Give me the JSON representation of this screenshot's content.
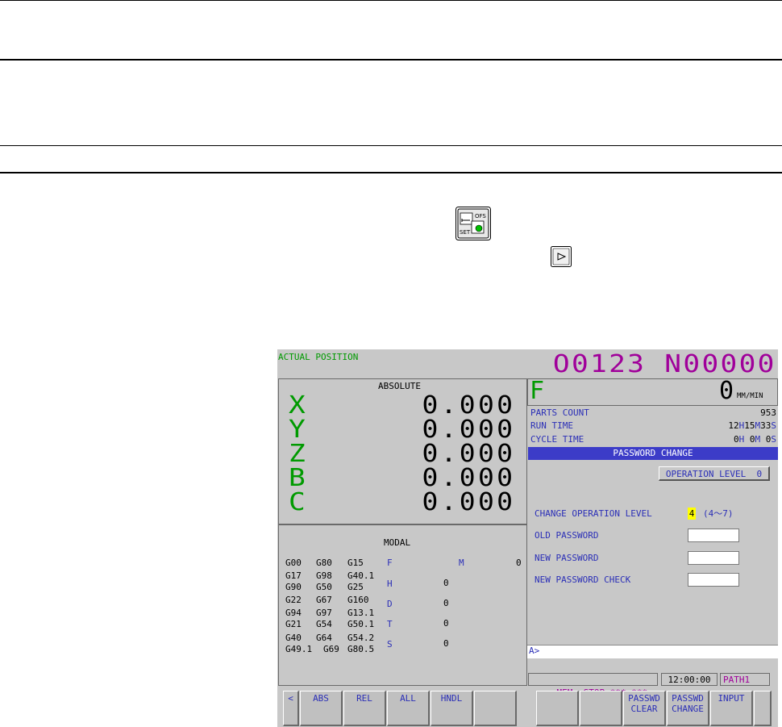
{
  "cnc": {
    "screen_title": "ACTUAL POSITION",
    "program_number": "O0123 N00000",
    "absolute_header": "ABSOLUTE",
    "axes": [
      {
        "label": "X",
        "value": "0.000"
      },
      {
        "label": "Y",
        "value": "0.000"
      },
      {
        "label": "Z",
        "value": "0.000"
      },
      {
        "label": "B",
        "value": "0.000"
      },
      {
        "label": "C",
        "value": "0.000"
      }
    ],
    "feed_label": "F",
    "feed_value": "0",
    "feed_unit": "MM/MIN",
    "parts_count_label": "PARTS COUNT",
    "parts_count_value": "953",
    "run_time_label": "RUN TIME",
    "run_time": {
      "h": "12",
      "m": "15",
      "s": "33"
    },
    "cycle_time_label": "CYCLE TIME",
    "cycle_time": {
      "h": "0",
      "m": "0",
      "s": "0"
    },
    "time_units": {
      "h": "H",
      "m": "M",
      "s": "S"
    },
    "modal_header": "MODAL",
    "modal_codes": [
      [
        "G00",
        "G80",
        "G15"
      ],
      [
        "G17",
        "G98",
        "G40.1"
      ],
      [
        "G90",
        "G50",
        "G25"
      ],
      [
        "G22",
        "G67",
        "G160"
      ],
      [
        "G94",
        "G97",
        "G13.1"
      ],
      [
        "G21",
        "G54",
        "G50.1"
      ],
      [
        "G40",
        "G64",
        "G54.2"
      ],
      [
        "G49.1",
        "G69",
        "G80.5"
      ]
    ],
    "modal_f_label": "F",
    "modal_m_label": "M",
    "modal_m_value": "0",
    "modal_h_label": "H",
    "modal_h_value": "0",
    "modal_d_label": "D",
    "modal_d_value": "0",
    "modal_t_label": "T",
    "modal_t_value": "0",
    "modal_s_label": "S",
    "modal_s_value": "0",
    "password_change_title": "PASSWORD CHANGE",
    "operation_level_button": "OPERATION LEVEL  0",
    "change_level_label": "CHANGE OPERATION LEVEL",
    "change_level_value": "4",
    "change_level_range": "(4～7)",
    "old_password_label": "OLD PASSWORD",
    "new_password_label": "NEW PASSWORD",
    "new_password_check_label": "NEW PASSWORD CHECK",
    "input_prompt": "A>",
    "status_mode": "MEM  STOP *** ***",
    "status_time": "12:00:00",
    "status_path": "PATH1",
    "softkeys": {
      "back": "<",
      "abs": "ABS",
      "rel": "REL",
      "all": "ALL",
      "hndl": "HNDL",
      "passwd_clear_1": "PASSWD",
      "passwd_clear_2": "CLEAR",
      "passwd_change_1": "PASSWD",
      "passwd_change_2": "CHANGE",
      "input": "INPUT"
    }
  },
  "icons": {
    "offset_setting_key": "offset-setting-key-icon",
    "next_softkey": "next-menu-key-icon"
  },
  "colors": {
    "green": "#009a00",
    "blue": "#2b2fb7",
    "magenta": "#a0009a",
    "title_bar": "#3c3cc8",
    "screen_bg": "#c8c8c8"
  }
}
